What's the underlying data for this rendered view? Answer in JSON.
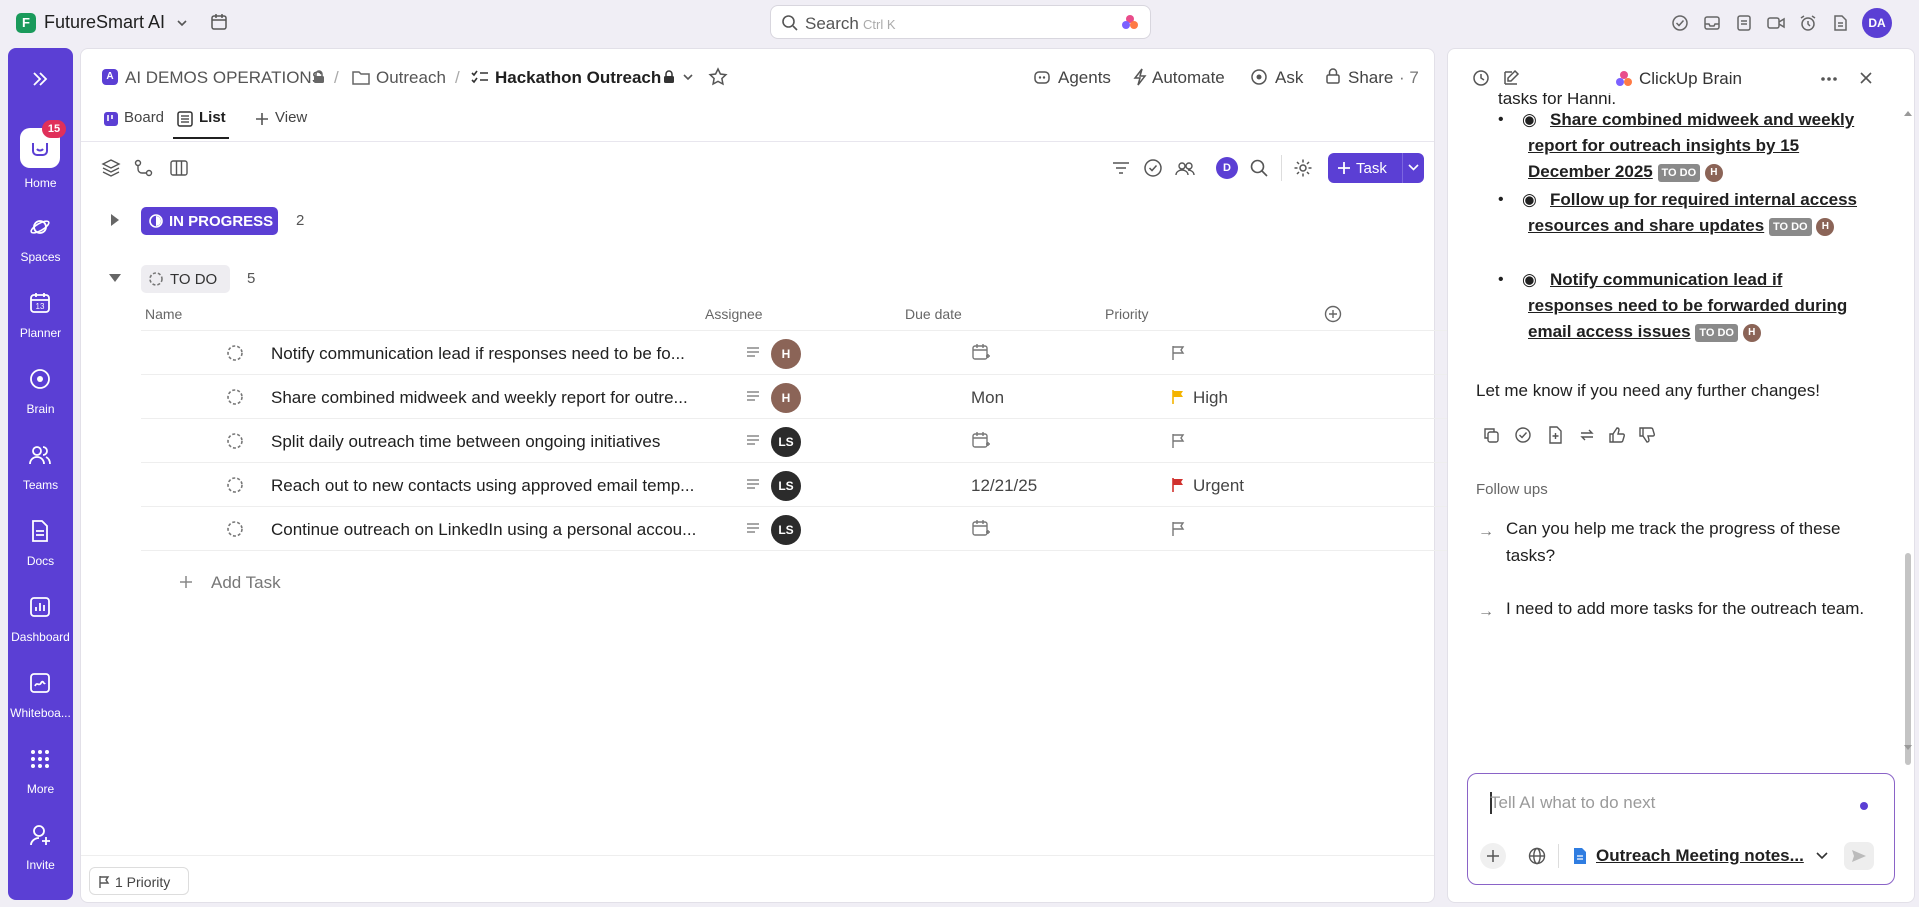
{
  "workspace": {
    "badge": "F",
    "name": "FutureSmart AI"
  },
  "search": {
    "label": "Search",
    "shortcut": "Ctrl K"
  },
  "rail": {
    "notification_count": "15",
    "items": [
      "Home",
      "Spaces",
      "Planner",
      "Brain",
      "Teams",
      "Docs",
      "Dashboard",
      "Whiteboa...",
      "More",
      "Invite"
    ]
  },
  "breadcrumb": {
    "space": "AI DEMOS OPERATIONS",
    "folder": "Outreach",
    "list": "Hackathon Outreach",
    "separator": "/"
  },
  "header_actions": {
    "agents": "Agents",
    "automate": "Automate",
    "ask": "Ask",
    "share": "Share",
    "share_count": "· 7"
  },
  "tabs": {
    "board": "Board",
    "list": "List",
    "view": "View"
  },
  "toolbar": {
    "user_badge": "D",
    "task_button": "Task"
  },
  "groups": {
    "in_progress": {
      "label": "IN PROGRESS",
      "count": "2"
    },
    "todo": {
      "label": "TO DO",
      "count": "5"
    }
  },
  "columns": {
    "name": "Name",
    "assignee": "Assignee",
    "due": "Due date",
    "priority": "Priority"
  },
  "tasks": [
    {
      "name": "Notify communication lead if responses need to be fo...",
      "assignee": "H",
      "due": "",
      "priority": ""
    },
    {
      "name": "Share combined midweek and weekly report for outre...",
      "assignee": "H",
      "due": "Mon",
      "priority": "High"
    },
    {
      "name": "Split daily outreach time between ongoing initiatives",
      "assignee": "LS",
      "due": "",
      "priority": ""
    },
    {
      "name": "Reach out to new contacts using approved email temp...",
      "assignee": "LS",
      "due": "12/21/25",
      "priority": "Urgent"
    },
    {
      "name": "Continue outreach on LinkedIn using a personal accou...",
      "assignee": "LS",
      "due": "",
      "priority": ""
    }
  ],
  "add_task": "Add Task",
  "footer": {
    "priority_filter": "1 Priority"
  },
  "brain": {
    "title": "ClickUp Brain",
    "cut_text": "tasks for Hanni.",
    "items": [
      {
        "text": "Share combined midweek and weekly report for outreach insights by 15 December 2025",
        "status": "TO DO",
        "assignee": "H"
      },
      {
        "text": "Follow up for required internal access resources and share updates",
        "status": "TO DO",
        "assignee": "H"
      },
      {
        "text": "Notify communication lead if responses need to be forwarded during email access issues",
        "status": "TO DO",
        "assignee": "H"
      }
    ],
    "closing": "Let me know if you need any further changes!",
    "followups_title": "Follow ups",
    "followups": [
      "Can you help me track the progress of these tasks?",
      "I need to add more tasks for the outreach team."
    ],
    "input_placeholder": "Tell AI what to do next",
    "context_doc": "Outreach Meeting notes..."
  },
  "colors": {
    "accent": "#5b3fd4",
    "urgent": "#d0312d",
    "high": "#f4b400"
  }
}
